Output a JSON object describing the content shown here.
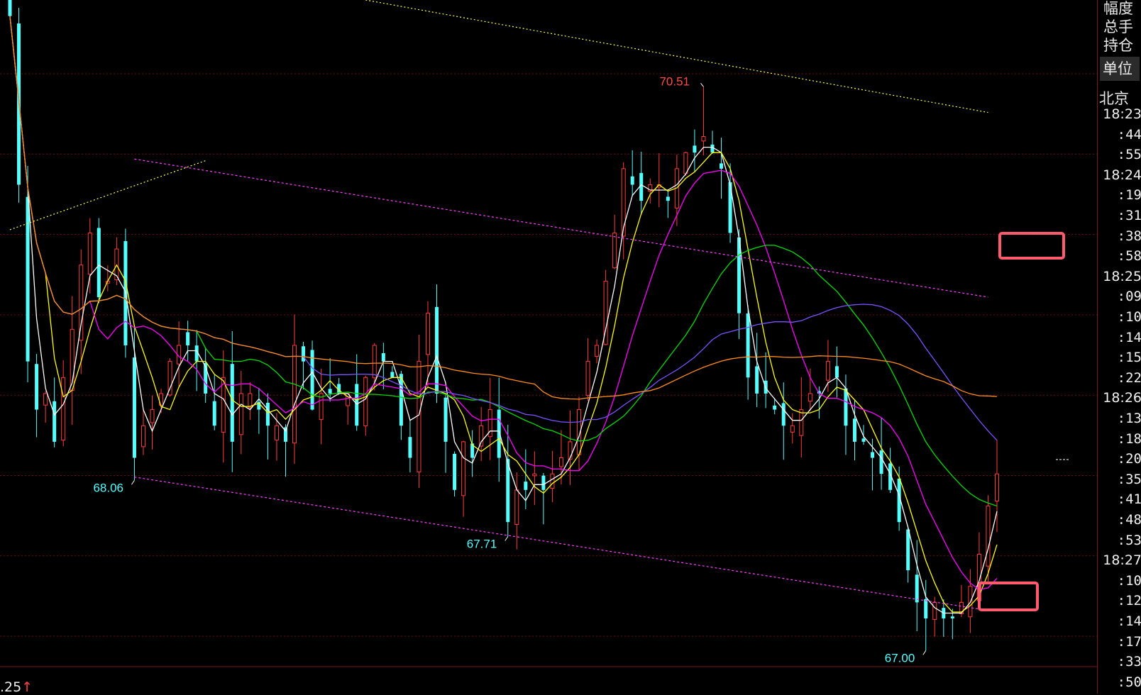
{
  "side_panel": {
    "labels": [
      "幅度",
      "总手",
      "持仓"
    ],
    "unit_label": "单位",
    "city": "北京",
    "time_ticks": [
      "18:23",
      ":44",
      ":55",
      "18:24",
      ":19",
      ":31",
      ":38",
      ":58",
      "18:25",
      ":09",
      ":10",
      ":14",
      ":15",
      ":22",
      "18:26",
      ":13",
      ":18",
      ":20",
      ":35",
      ":41",
      ":48",
      ":53",
      "18:27",
      ":10",
      ":12",
      ":14",
      ":17",
      ":33",
      ":50"
    ]
  },
  "bottom": {
    "value": ".25",
    "arrow": "↑"
  },
  "colors": {
    "bull": "#ff3b3b",
    "bear": "#54ffff",
    "ma5": "#ffffff",
    "ma10": "#ffff00",
    "ma20": "#ff00ff",
    "ma40": "#00dd00",
    "ma60": "#7b52ff",
    "ma120": "#ff8c1a",
    "channel": "#ff40ff",
    "trend": "#ffff55",
    "grid": "#6b0f0f",
    "highlight": "#ff5a6e"
  },
  "chart_data": {
    "type": "candlestick",
    "ylim": [
      66.9,
      71.05
    ],
    "price_labels": [
      {
        "text": "70.51",
        "value": 70.51,
        "index": 78,
        "color": "#ff4a4a"
      },
      {
        "text": "68.06",
        "value": 68.06,
        "index": 14,
        "color": "#54ffff"
      },
      {
        "text": "67.71",
        "value": 67.71,
        "index": 56,
        "color": "#54ffff"
      },
      {
        "text": "67.00",
        "value": 67.0,
        "index": 103,
        "color": "#54ffff"
      }
    ],
    "close_path": [
      70.95,
      69.9,
      68.8,
      68.5,
      68.6,
      68.3,
      68.7,
      69.0,
      69.4,
      69.6,
      69.2,
      69.3,
      69.5,
      68.9,
      68.2,
      68.4,
      68.5,
      68.6,
      68.8,
      68.9,
      68.9,
      68.8,
      68.6,
      68.4,
      68.7,
      68.3,
      68.6,
      68.6,
      68.5,
      68.4,
      68.4,
      68.3,
      68.9,
      68.8,
      68.5,
      68.6,
      68.6,
      68.6,
      68.6,
      68.4,
      68.7,
      68.9,
      68.8,
      68.7,
      68.4,
      68.2,
      68.8,
      69.1,
      68.6,
      68.3,
      68.0,
      68.3,
      68.2,
      68.4,
      68.5,
      68.2,
      67.8,
      68.0,
      68.0,
      68.1,
      68.0,
      68.1,
      68.2,
      68.3,
      68.5,
      68.8,
      68.9,
      69.3,
      69.6,
      70.0,
      69.9,
      69.8,
      69.9,
      69.9,
      69.8,
      70.0,
      70.1,
      70.1,
      70.2,
      70.1,
      70.0,
      69.6,
      69.1,
      68.7,
      68.6,
      68.6,
      68.5,
      68.4,
      68.4,
      68.5,
      68.6,
      68.6,
      68.8,
      68.7,
      68.4,
      68.3,
      68.3,
      68.2,
      68.1,
      68.0,
      67.8,
      67.5,
      67.3,
      67.2,
      67.3,
      67.2,
      67.2,
      67.3,
      67.4,
      67.6,
      67.9,
      68.1
    ],
    "high_low_range": {
      "high": 70.51,
      "low": 67.0
    },
    "moving_averages": [
      "MA5",
      "MA10",
      "MA20",
      "MA40",
      "MA60",
      "MA120"
    ],
    "channel_lines": [
      {
        "from": [
          14,
          70.06
        ],
        "to": [
          110,
          69.2
        ]
      },
      {
        "from": [
          14,
          68.08
        ],
        "to": [
          110,
          67.25
        ]
      }
    ],
    "trend_lines": [
      {
        "from": [
          40,
          71.05
        ],
        "to": [
          110,
          70.35
        ]
      },
      {
        "from": [
          0,
          69.62
        ],
        "to": [
          22,
          70.05
        ]
      }
    ]
  }
}
